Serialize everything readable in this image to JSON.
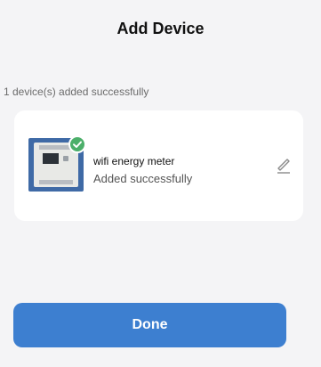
{
  "header": {
    "title": "Add Device"
  },
  "summary": {
    "text": "1 device(s) added successfully"
  },
  "device": {
    "name": "wifi energy meter",
    "status": "Added successfully",
    "icons": {
      "thumbnail": "energy-meter-image",
      "badge": "check-icon",
      "edit": "pencil-icon"
    },
    "badge_color": "#4caf6a"
  },
  "footer": {
    "done_label": "Done"
  },
  "colors": {
    "background": "#f4f4f6",
    "card": "#ffffff",
    "primary": "#3d7fd0"
  }
}
